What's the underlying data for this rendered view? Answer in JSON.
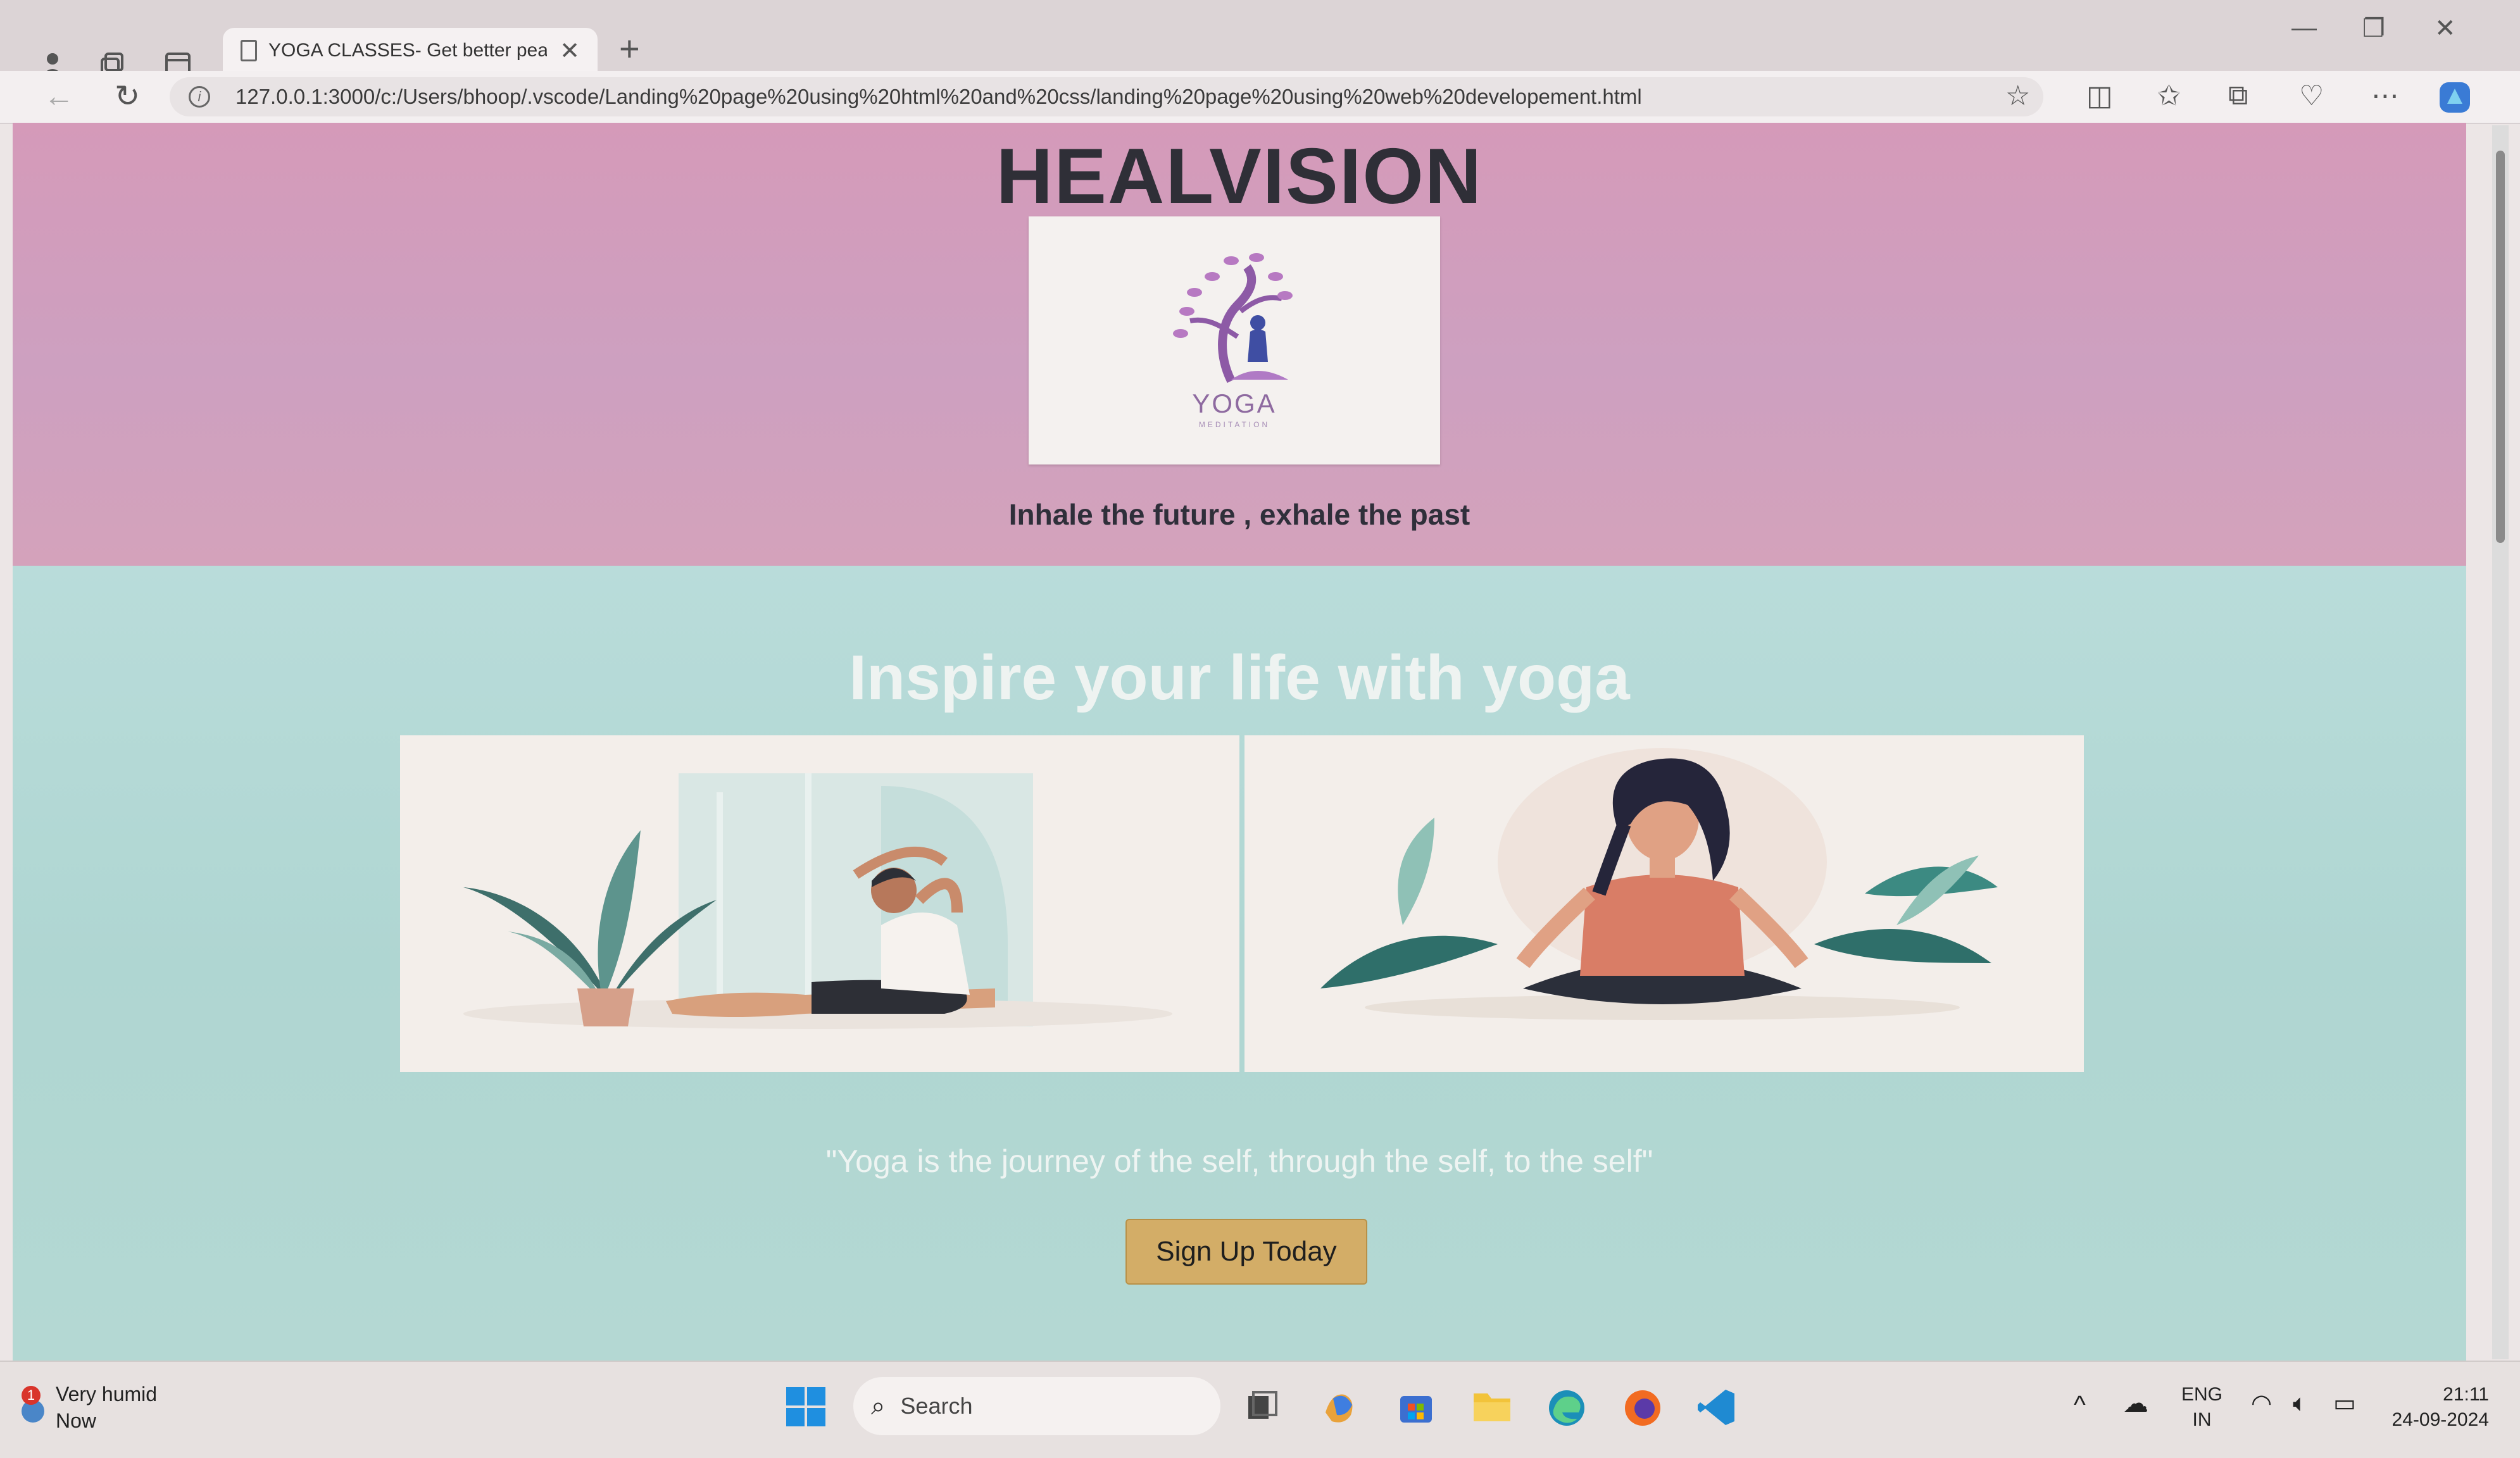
{
  "browser": {
    "tab_title": "YOGA CLASSES- Get better peace",
    "url": "127.0.0.1:3000/c:/Users/bhoop/.vscode/Landing%20page%20using%20html%20and%20css/landing%20page%20using%20web%20developement.html"
  },
  "page": {
    "site_title": "HEALVISION",
    "logo": {
      "text": "YOGA",
      "subtext": "MEDITATION"
    },
    "tagline": "Inhale the future , exhale the past",
    "section_heading": "Inspire your life with yoga",
    "quote": "\"Yoga is the journey of the self, through the self, to the self\"",
    "signup_label": "Sign Up Today"
  },
  "taskbar": {
    "weather": {
      "badge": "1",
      "line1": "Very humid",
      "line2": "Now"
    },
    "search_label": "Search",
    "lang_line1": "ENG",
    "lang_line2": "IN",
    "time": "21:11",
    "date": "24-09-2024"
  },
  "colors": {
    "hero_bg": "#d59ab9",
    "section_bg": "#b9dcda",
    "button_bg": "#d3ad67",
    "title_color": "#2f2f37"
  }
}
